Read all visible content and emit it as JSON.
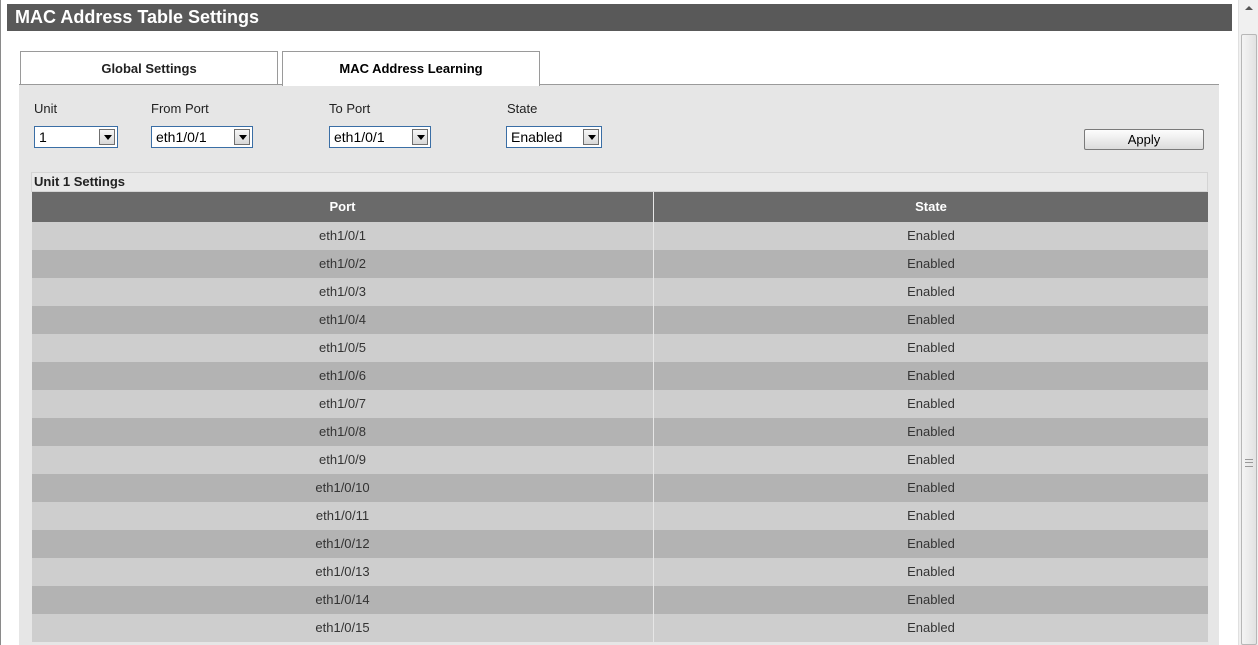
{
  "window": {
    "title": "MAC Address Table Settings"
  },
  "tabs": [
    {
      "label": "Global Settings",
      "active": false
    },
    {
      "label": "MAC Address Learning",
      "active": true
    }
  ],
  "form": {
    "unit": {
      "label": "Unit",
      "value": "1"
    },
    "from_port": {
      "label": "From Port",
      "value": "eth1/0/1"
    },
    "to_port": {
      "label": "To Port",
      "value": "eth1/0/1"
    },
    "state": {
      "label": "State",
      "value": "Enabled"
    },
    "apply_label": "Apply"
  },
  "section": {
    "title": "Unit 1 Settings"
  },
  "table": {
    "headers": [
      "Port",
      "State"
    ],
    "rows": [
      [
        "eth1/0/1",
        "Enabled"
      ],
      [
        "eth1/0/2",
        "Enabled"
      ],
      [
        "eth1/0/3",
        "Enabled"
      ],
      [
        "eth1/0/4",
        "Enabled"
      ],
      [
        "eth1/0/5",
        "Enabled"
      ],
      [
        "eth1/0/6",
        "Enabled"
      ],
      [
        "eth1/0/7",
        "Enabled"
      ],
      [
        "eth1/0/8",
        "Enabled"
      ],
      [
        "eth1/0/9",
        "Enabled"
      ],
      [
        "eth1/0/10",
        "Enabled"
      ],
      [
        "eth1/0/11",
        "Enabled"
      ],
      [
        "eth1/0/12",
        "Enabled"
      ],
      [
        "eth1/0/13",
        "Enabled"
      ],
      [
        "eth1/0/14",
        "Enabled"
      ],
      [
        "eth1/0/15",
        "Enabled"
      ]
    ]
  },
  "colors": {
    "title_bar": "#595959",
    "table_header": "#6a6a6a",
    "row_light": "#cecece",
    "row_dark": "#b3b3b3"
  }
}
